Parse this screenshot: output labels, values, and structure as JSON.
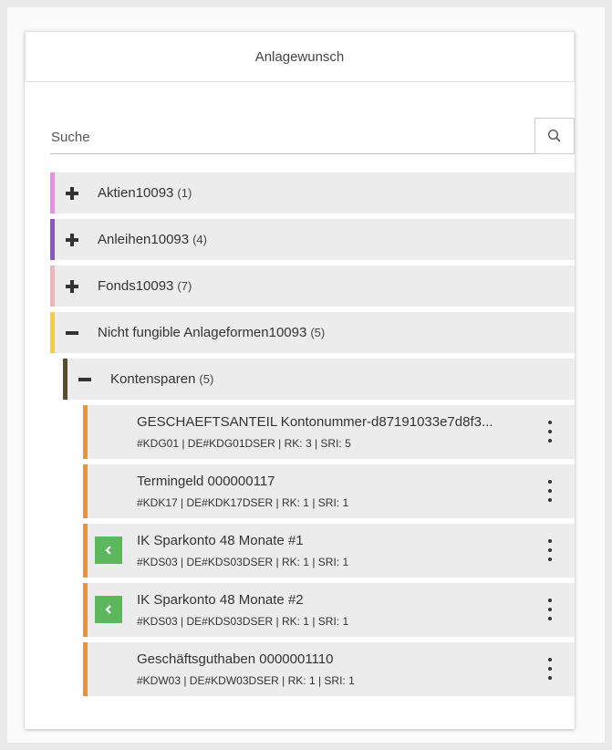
{
  "header": {
    "title": "Anlagewunsch"
  },
  "search": {
    "placeholder": "Suche",
    "icon": "search-icon"
  },
  "colors": {
    "aktien": "#f08ce6",
    "anleihen": "#8a55c4",
    "fonds": "#f2b3bf",
    "nicht_fungible": "#f4d03f",
    "kontensparen": "#5c4d2a",
    "leaf": "#f0932b",
    "action": "#5cb85c"
  },
  "tree": {
    "categories": [
      {
        "label": "Aktien10093",
        "count": "(1)",
        "state": "collapsed"
      },
      {
        "label": "Anleihen10093",
        "count": "(4)",
        "state": "collapsed"
      },
      {
        "label": "Fonds10093",
        "count": "(7)",
        "state": "collapsed"
      },
      {
        "label": "Nicht fungible Anlageformen10093",
        "count": "(5)",
        "state": "expanded"
      }
    ],
    "subcategory": {
      "label": "Kontensparen",
      "count": "(5)",
      "state": "expanded"
    },
    "items": [
      {
        "title": "GESCHAEFTSANTEIL Kontonummer-d87191033e7d8f3...",
        "meta": "#KDG01 | DE#KDG01DSER | RK: 3 | SRI: 5",
        "has_action": false
      },
      {
        "title": "Termingeld 000000117",
        "meta": "#KDK17 | DE#KDK17DSER | RK: 1 | SRI: 1",
        "has_action": false
      },
      {
        "title": "IK Sparkonto 48 Monate #1",
        "meta": "#KDS03 | DE#KDS03DSER | RK: 1 | SRI: 1",
        "has_action": true
      },
      {
        "title": "IK Sparkonto 48 Monate #2",
        "meta": "#KDS03 | DE#KDS03DSER | RK: 1 | SRI: 1",
        "has_action": true
      },
      {
        "title": "Geschäftsguthaben 0000001110",
        "meta": "#KDW03 | DE#KDW03DSER | RK: 1 | SRI: 1",
        "has_action": false
      }
    ]
  }
}
